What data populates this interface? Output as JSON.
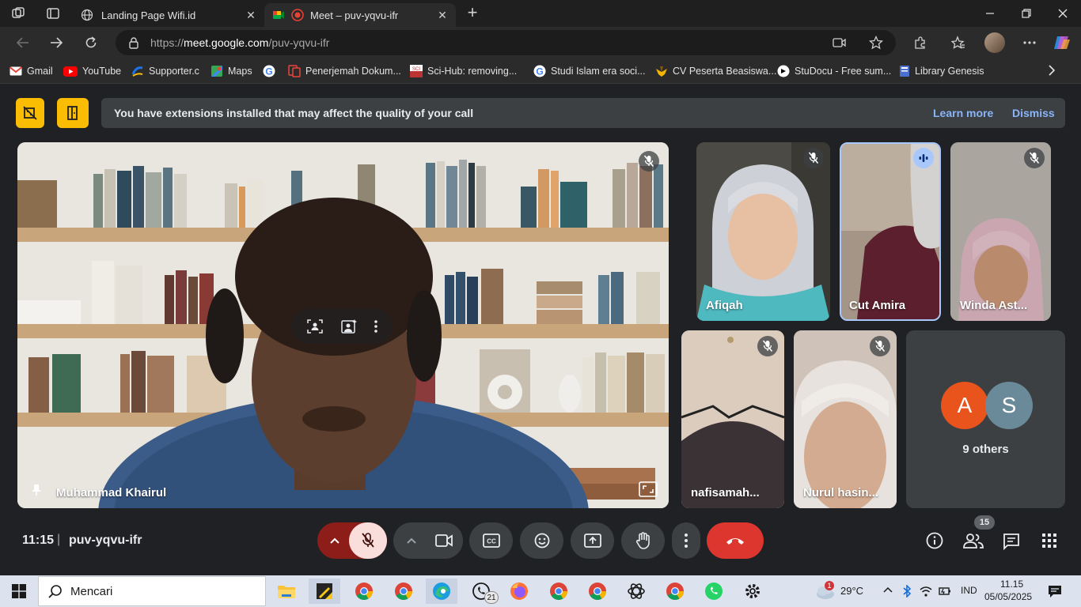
{
  "browser": {
    "tabs": [
      {
        "title": "Landing Page Wifi.id",
        "active": false
      },
      {
        "title": "Meet – puv-yqvu-ifr",
        "active": true
      }
    ],
    "url_prefix": "https://",
    "url_host": "meet.google.com",
    "url_path": "/puv-yqvu-ifr",
    "bookmarks": [
      {
        "label": "Gmail",
        "icon": "gmail-icon",
        "color": "#ea4335"
      },
      {
        "label": "YouTube",
        "icon": "youtube-icon",
        "color": "#ff0000"
      },
      {
        "label": "Supporter.c",
        "icon": "supporter-icon",
        "color": "#1a73e8"
      },
      {
        "label": "Maps",
        "icon": "maps-icon",
        "color": "#34a853"
      },
      {
        "label": "",
        "icon": "google-icon",
        "color": "#ffffff"
      },
      {
        "label": "Penerjemah Dokum...",
        "icon": "translate-icon",
        "color": "#e8453c"
      },
      {
        "label": "Sci-Hub: removing...",
        "icon": "scihub-icon",
        "color": "#b33"
      },
      {
        "label": "Studi Islam era soci...",
        "icon": "google-icon",
        "color": "#ffffff"
      },
      {
        "label": "CV Peserta Beasiswa...",
        "icon": "bird-icon",
        "color": "#f4b400"
      },
      {
        "label": "StuDocu - Free sum...",
        "icon": "studocu-icon",
        "color": "#ffffff"
      },
      {
        "label": "Library Genesis",
        "icon": "libgen-icon",
        "color": "#4a6fd1"
      }
    ]
  },
  "banner": {
    "text": "You have extensions installed that may affect the quality of your call",
    "learn_more": "Learn more",
    "dismiss": "Dismiss"
  },
  "participants": {
    "main": {
      "name": "Muhammad Khairul"
    },
    "tiles": [
      {
        "name": "Afiqah",
        "muted": true
      },
      {
        "name": "Cut Amira",
        "muted": false,
        "speaking": true
      },
      {
        "name": "Winda Ast...",
        "muted": true
      },
      {
        "name": "nafisamah...",
        "muted": true
      },
      {
        "name": "Nurul hasin...",
        "muted": true
      }
    ],
    "others": {
      "label": "9 others",
      "avatars": [
        {
          "letter": "A",
          "color": "#e8541c"
        },
        {
          "letter": "S",
          "color": "#6b8a99"
        }
      ]
    }
  },
  "controls": {
    "time": "11:15",
    "separator": "|",
    "meeting_code": "puv-yqvu-ifr",
    "people_count": "15"
  },
  "taskbar": {
    "search_placeholder": "Mencari",
    "weather": "29°C",
    "weather_badge": "1",
    "language": "IND",
    "clock_time": "11.15",
    "clock_date": "05/05/2025",
    "whatsapp_badge": "21"
  }
}
